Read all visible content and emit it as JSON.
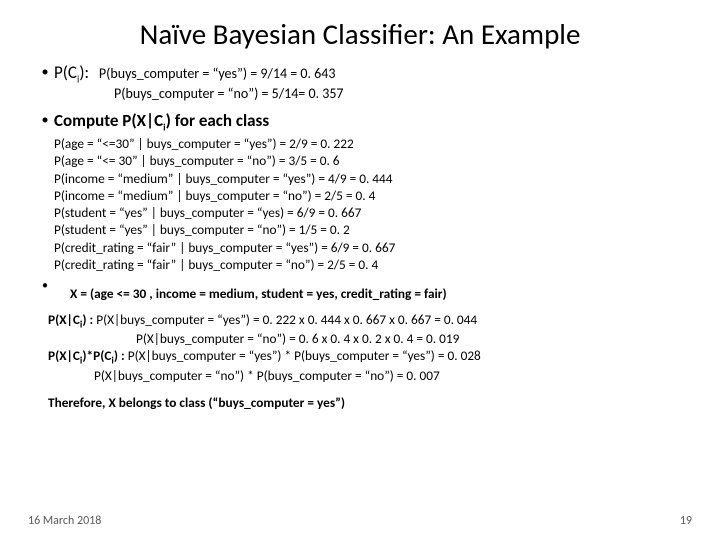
{
  "title": "Naïve Bayesian Classifier:  An Example",
  "pci": {
    "label_pre": "P(C",
    "label_sub": "i",
    "label_post": "):",
    "l1": "P(buys_computer = “yes”)  = 9/14 = 0. 643",
    "l2": "P(buys_computer = “no”) = 5/14= 0. 357"
  },
  "compute_pre": "Compute P(X|C",
  "compute_sub": "i",
  "compute_post": ") for each class",
  "probs": [
    "P(age = “<=30” | buys_computer = “yes”) = 2/9 = 0. 222",
    "P(age = “<= 30” | buys_computer = “no”) = 3/5 = 0. 6",
    "P(income = “medium” | buys_computer = “yes”) = 4/9 = 0. 444",
    "P(income = “medium” | buys_computer = “no”) = 2/5 = 0. 4",
    "P(student = “yes” | buys_computer = “yes) = 6/9 = 0. 667",
    "P(student = “yes” | buys_computer = “no”) = 1/5 = 0. 2",
    "P(credit_rating = “fair” | buys_computer = “yes”) = 6/9 = 0. 667",
    "P(credit_rating = “fair” | buys_computer = “no”) = 2/5 = 0. 4"
  ],
  "xdef": "X = (age <= 30 , income = medium, student = yes, credit_rating = fair)",
  "calc": {
    "h1": " P(X|C",
    "h1s": "i",
    "h1p": ") : ",
    "l1": "P(X|buys_computer = “yes”) = 0. 222 x 0. 444 x 0. 667 x 0. 667 = 0. 044",
    "l2": "P(X|buys_computer = “no”) = 0. 6 x 0. 4 x 0. 2 x 0. 4 = 0. 019",
    "h2": "P(X|C",
    "h2s": "i",
    "h2m": ")*P(C",
    "h2s2": "i",
    "h2p": ") : ",
    "l3": "P(X|buys_computer = “yes”) * P(buys_computer = “yes”) = 0. 028",
    "l4": "P(X|buys_computer = “no”) * P(buys_computer = “no”) = 0. 007"
  },
  "therefore": "Therefore,  X belongs to class (“buys_computer = yes”)",
  "footer": {
    "date": "16 March 2018",
    "page": "19"
  }
}
